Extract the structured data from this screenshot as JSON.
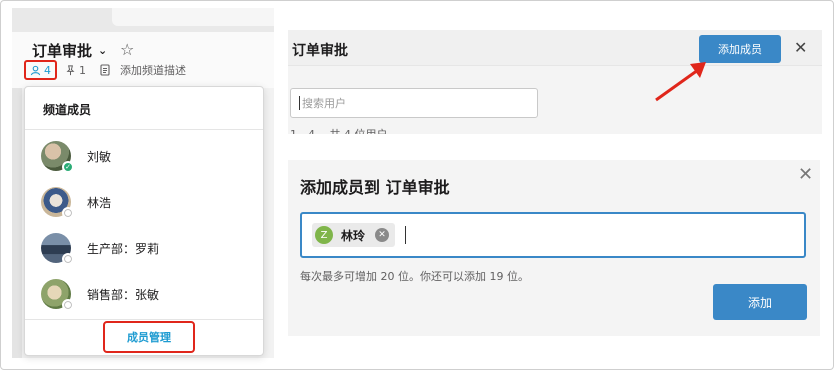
{
  "colors": {
    "accent": "#3a88c7",
    "highlight_border": "#e0261b",
    "online": "#2bac76"
  },
  "channel": {
    "name": "订单审批",
    "member_count": "4",
    "pin_count": "1",
    "add_description": "添加频道描述"
  },
  "members_dropdown": {
    "title": "频道成员",
    "members": [
      {
        "name": "刘敏",
        "status": "online"
      },
      {
        "name": "林浩",
        "status": "offline"
      },
      {
        "name": "生产部：罗莉",
        "status": "offline"
      },
      {
        "name": "销售部：张敏",
        "status": "offline"
      }
    ],
    "manage_label": "成员管理"
  },
  "members_panel": {
    "title": "订单审批",
    "add_member_label": "添加成员",
    "search_placeholder": "搜索用户",
    "count_text": "1 - 4 ，共 4 位用户"
  },
  "add_dialog": {
    "title": "添加成员到 订单审批",
    "chip_initial": "Z",
    "chip_name": "林玲",
    "hint": "每次最多可增加 20 位。你还可以添加 19 位。",
    "add_label": "添加"
  },
  "icons": {
    "close": "close-icon",
    "star": "star-icon",
    "person": "person-icon",
    "pin": "pin-icon",
    "document": "document-icon",
    "chevron": "chevron-down-icon"
  }
}
